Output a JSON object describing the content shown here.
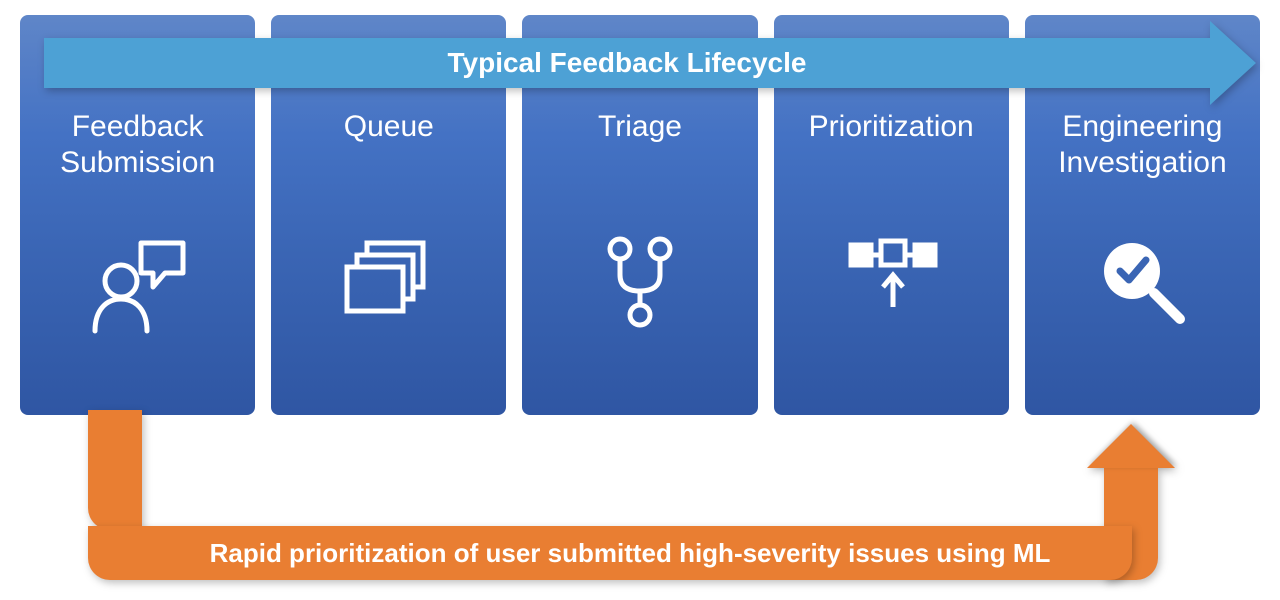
{
  "colors": {
    "stage_gradient_top": "#5f86c8",
    "stage_gradient_bottom": "#2f56a3",
    "top_arrow": "#4da1d5",
    "ml_arrow": "#e97e32"
  },
  "top_arrow_label": "Typical Feedback Lifecycle",
  "ml_arrow_label": "Rapid prioritization of user submitted high-severity issues using ML",
  "stages": [
    {
      "label": "Feedback Submission",
      "icon": "person-feedback-icon"
    },
    {
      "label": "Queue",
      "icon": "stack-icon"
    },
    {
      "label": "Triage",
      "icon": "branch-icon"
    },
    {
      "label": "Prioritization",
      "icon": "priority-icon"
    },
    {
      "label": "Engineering Investigation",
      "icon": "magnify-check-icon"
    }
  ]
}
